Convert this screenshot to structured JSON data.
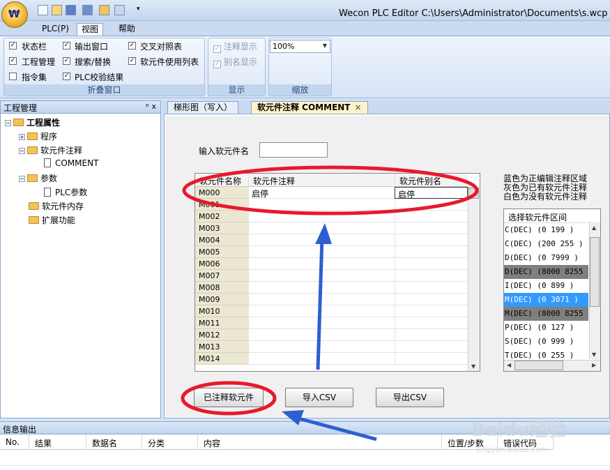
{
  "window": {
    "title": "Wecon PLC Editor  C:\\Users\\Administrator\\Documents\\s.wcp  - 软元"
  },
  "menus": [
    "PLC(P)",
    "视图",
    "帮助"
  ],
  "ribbon": {
    "panes_group": {
      "title": "折叠窗口",
      "items": [
        {
          "label": "状态栏",
          "checked": true
        },
        {
          "label": "输出窗口",
          "checked": true
        },
        {
          "label": "交叉对照表",
          "checked": true
        },
        {
          "label": "工程管理",
          "checked": true
        },
        {
          "label": "搜索/替换",
          "checked": true
        },
        {
          "label": "软元件使用列表",
          "checked": true
        },
        {
          "label": "指令集",
          "checked": false
        },
        {
          "label": "PLC校验结果",
          "checked": true
        }
      ]
    },
    "display_group": {
      "title": "显示",
      "items": [
        {
          "label": "注释显示",
          "checked": true
        },
        {
          "label": "别名显示",
          "checked": true
        }
      ]
    },
    "zoom_group": {
      "title": "缩放",
      "value": "100%"
    }
  },
  "project_panel": {
    "title": "工程管理",
    "pin": "ᵖ x",
    "tree": [
      {
        "label": "工程属性",
        "bold": true
      },
      {
        "label": "程序"
      },
      {
        "label": "软元件注释"
      },
      {
        "label": "COMMENT"
      },
      {
        "label": "参数"
      },
      {
        "label": "PLC参数"
      },
      {
        "label": "软元件内存"
      },
      {
        "label": "扩展功能"
      }
    ]
  },
  "tabs": [
    {
      "label": "梯形图（写入）"
    },
    {
      "label": "软元件注释 COMMENT",
      "active": true,
      "close": "×"
    }
  ],
  "comment_editor": {
    "input_label": "输入软元件名",
    "input_value": "",
    "columns": [
      "软元件名称",
      "软元件注释",
      "软元件别名"
    ],
    "rows": [
      {
        "name": "M000",
        "comment": "启停",
        "alias": "启停"
      },
      {
        "name": "M001",
        "comment": "",
        "alias": ""
      },
      {
        "name": "M002",
        "comment": "",
        "alias": ""
      },
      {
        "name": "M003",
        "comment": "",
        "alias": ""
      },
      {
        "name": "M004",
        "comment": "",
        "alias": ""
      },
      {
        "name": "M005",
        "comment": "",
        "alias": ""
      },
      {
        "name": "M006",
        "comment": "",
        "alias": ""
      },
      {
        "name": "M007",
        "comment": "",
        "alias": ""
      },
      {
        "name": "M008",
        "comment": "",
        "alias": ""
      },
      {
        "name": "M009",
        "comment": "",
        "alias": ""
      },
      {
        "name": "M010",
        "comment": "",
        "alias": ""
      },
      {
        "name": "M011",
        "comment": "",
        "alias": ""
      },
      {
        "name": "M012",
        "comment": "",
        "alias": ""
      },
      {
        "name": "M013",
        "comment": "",
        "alias": ""
      },
      {
        "name": "M014",
        "comment": "",
        "alias": ""
      }
    ],
    "hints": [
      "蓝色为正编辑注释区域",
      "灰色为已有软元件注释",
      "白色为没有软元件注释"
    ],
    "range_list_title": "选择软元件区间",
    "ranges": [
      {
        "label": "C(DEC)  (0  199 )",
        "state": "none"
      },
      {
        "label": "C(DEC)  (200 255 )",
        "state": "none"
      },
      {
        "label": "D(DEC)  (0  7999 )",
        "state": "none"
      },
      {
        "label": "D(DEC)  (8000 8255 )",
        "state": "has"
      },
      {
        "label": "I(DEC)  (0  899 )",
        "state": "none"
      },
      {
        "label": "M(DEC)  (0  3071 )",
        "state": "editing"
      },
      {
        "label": "M(DEC)  (8000 8255 )",
        "state": "has"
      },
      {
        "label": "P(DEC)  (0  127 )",
        "state": "none"
      },
      {
        "label": "S(DEC)  (0  999 )",
        "state": "none"
      },
      {
        "label": "T(DEC)  (0  255 )",
        "state": "none"
      }
    ],
    "buttons": {
      "commented": "已注释软元件",
      "import": "导入CSV",
      "export": "导出CSV"
    }
  },
  "output_panel": {
    "title": "信息输出",
    "columns": [
      "No.",
      "结果",
      "数据名",
      "分类",
      "内容",
      "位置/步数",
      "错误代码"
    ]
  },
  "watermark": {
    "text": "Baidu经验",
    "sub": "jingyan.baidu.com"
  },
  "colors": {
    "accent": "#3399ff",
    "annotation": "#e8192c",
    "arrow": "#2d5fd0",
    "has_comment": "#7f7f7f"
  }
}
